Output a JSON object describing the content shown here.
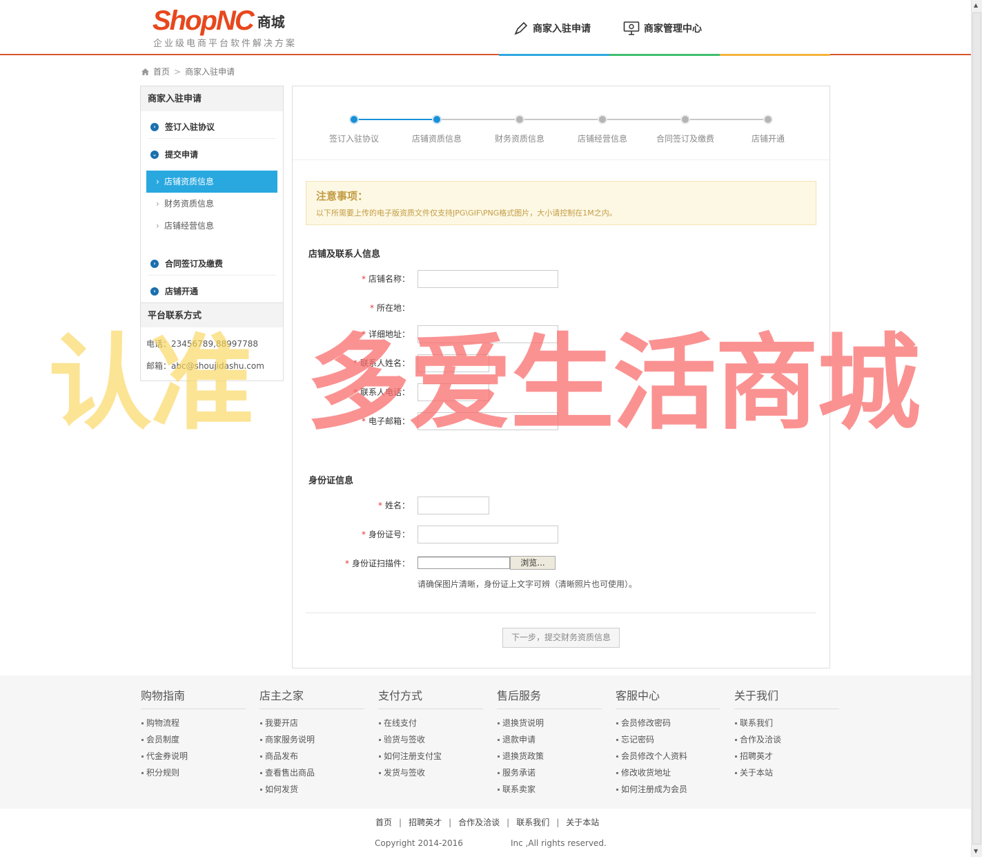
{
  "header": {
    "brand": "ShopNC",
    "brand_cn": "商城",
    "slogan": "企业级电商平台软件解决方案",
    "nav": [
      "商家入驻申请",
      "商家管理中心"
    ]
  },
  "breadcrumb": {
    "home": "首页",
    "current": "商家入驻申请"
  },
  "sidebar": {
    "title": "商家入驻申请",
    "steps": [
      "签订入驻协议",
      "提交申请",
      "合同签订及缴费",
      "店铺开通"
    ],
    "sub_items": [
      "店铺资质信息",
      "财务资质信息",
      "店铺经营信息"
    ],
    "contact_title": "平台联系方式",
    "phone": "电话：23456789,88997788",
    "email": "邮箱：abc@shoujidashu.com"
  },
  "progress": {
    "steps": [
      "签订入驻协议",
      "店铺资质信息",
      "财务资质信息",
      "店铺经营信息",
      "合同签订及缴费",
      "店铺开通"
    ],
    "completed": 2
  },
  "notice": {
    "title": "注意事项：",
    "text": "以下所需要上传的电子版资质文件仅支持JPG\\GIF\\PNG格式图片，大小请控制在1M之内。"
  },
  "store_section": {
    "title": "店铺及联系人信息",
    "fields": [
      "店铺名称：",
      "所在地：",
      "详细地址：",
      "联系人姓名：",
      "联系人电话：",
      "电子邮箱："
    ]
  },
  "id_section": {
    "title": "身份证信息",
    "fields": [
      "姓名：",
      "身份证号：",
      "身份证扫描件："
    ],
    "browse": "浏览...",
    "hint": "请确保图片清晰，身份证上文字可辨（清晰照片也可使用）。"
  },
  "next_button": "下一步，提交财务资质信息",
  "watermark": [
    "认准",
    "多爱生活商城"
  ],
  "footer": {
    "columns": [
      {
        "title": "购物指南",
        "items": [
          "购物流程",
          "会员制度",
          "代金券说明",
          "积分规则"
        ]
      },
      {
        "title": "店主之家",
        "items": [
          "我要开店",
          "商家服务说明",
          "商品发布",
          "查看售出商品",
          "如何发货"
        ]
      },
      {
        "title": "支付方式",
        "items": [
          "在线支付",
          "验货与签收",
          "如何注册支付宝",
          "发货与签收"
        ]
      },
      {
        "title": "售后服务",
        "items": [
          "退换货说明",
          "退款申请",
          "退换货政策",
          "服务承诺",
          "联系卖家"
        ]
      },
      {
        "title": "客服中心",
        "items": [
          "会员修改密码",
          "忘记密码",
          "会员修改个人资料",
          "修改收货地址",
          "如何注册成为会员"
        ]
      },
      {
        "title": "关于我们",
        "items": [
          "联系我们",
          "合作及洽谈",
          "招聘英才",
          "关于本站"
        ]
      }
    ],
    "bottom_links": [
      "首页",
      "招聘英才",
      "合作及洽谈",
      "联系我们",
      "关于本站"
    ],
    "copyright": "Copyright 2014-2016",
    "rights": "Inc ,All rights reserved."
  },
  "colors": {
    "accent": "#29a8e0",
    "brand": "#e8471d",
    "header_line": "#d8572c",
    "required": "#e23a3a"
  }
}
